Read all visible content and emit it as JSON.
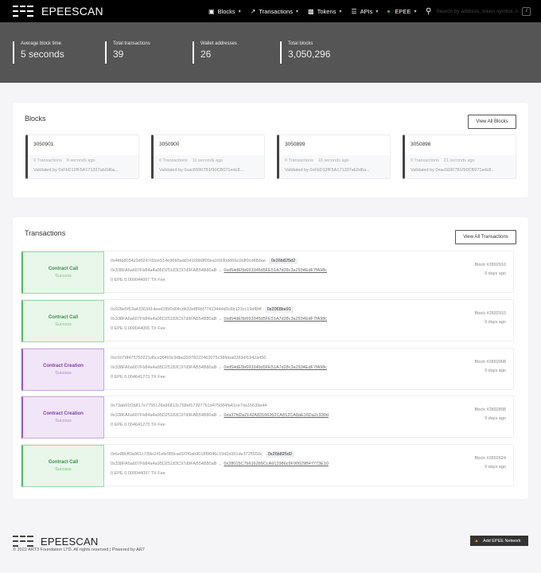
{
  "brand": {
    "name": "EPEESCAN"
  },
  "nav": {
    "items": [
      {
        "label": "Blocks",
        "icon": "cube-icon"
      },
      {
        "label": "Transactions",
        "icon": "transfer-icon"
      },
      {
        "label": "Tokens",
        "icon": "tokens-icon"
      },
      {
        "label": "APIs",
        "icon": "sliders-icon"
      },
      {
        "label": "EPEE",
        "icon": "network-dot-icon"
      }
    ],
    "search_placeholder": "Search by address, token symbol, n",
    "search_shortcut": "/"
  },
  "stats": [
    {
      "label": "Average block time",
      "value": "5 seconds"
    },
    {
      "label": "Total transactions",
      "value": "39"
    },
    {
      "label": "Wallet addresses",
      "value": "26"
    },
    {
      "label": "Total blocks",
      "value": "3,050,296"
    }
  ],
  "blocks": {
    "title": "Blocks",
    "view_all": "View All Blocks",
    "items": [
      {
        "number": "3050901",
        "tx_count": "0 Transactions",
        "age": "6 seconds ago",
        "validator": "Validated by 0xFbD12fF5A171337ab2d6a..."
      },
      {
        "number": "3050900",
        "tx_count": "0 Transactions",
        "age": "11 seconds ago",
        "validator": "Validated by 0xac66907B1f90CB071edc8..."
      },
      {
        "number": "3050899",
        "tx_count": "0 Transactions",
        "age": "16 seconds ago",
        "validator": "Validated by 0xFbD12fF5A171337ab2d6a..."
      },
      {
        "number": "3050898",
        "tx_count": "0 Transactions",
        "age": "21 seconds ago",
        "validator": "Validated by 0xac66907B1f90CB071edc8..."
      }
    ]
  },
  "transactions": {
    "title": "Transactions",
    "view_all": "View All Transactions",
    "items": [
      {
        "type": "Contract Call",
        "kind": "call",
        "status": "Success",
        "hash": "0x4fdb8034c0d9247d2ee514e96b5add14106b8f00ea16930dd6fa1bdf0cd88dae",
        "method": "0x26b825d2",
        "from": "0x338FA6a607Fb84a4a95D25183C97d9FAB54B80aB",
        "arrow": "→",
        "to": "0xd54dE5b693345d5FE51A7d28c3a2934EdF7fA98c",
        "value": "0 EPE",
        "fee": "0.000044097 TX Fee",
        "block": "Block #2892910",
        "age": "9 days ago"
      },
      {
        "type": "Contract Call",
        "kind": "call",
        "status": "Success",
        "hash": "0x928e5f53a43363414eed1f5f0d04cdb33ef85bf77413444d3c6b123cc19df84f",
        "method": "0x2068be91",
        "from": "0x338FA6a607Fb84a4a95D25183C97d9FAB54B80aB",
        "arrow": "→",
        "to": "0xd54dE5b693345d5FE51A7d28c3a2934EdF7fA98c",
        "value": "0 EPE",
        "fee": "0.000044056 TX Fee",
        "block": "Block #2892910",
        "age": "9 days ago"
      },
      {
        "type": "Contract Creation",
        "kind": "creation",
        "status": "Success",
        "hash": "0xc007df475750221d5cc06469c9dba29378222462075c38feba0283df1942a450",
        "method": "",
        "from": "0x338FA6a607Fb84a4a95D25183C97d9FAB54B80aB",
        "arrow": "→",
        "to": "0xd54dE5b693345d5FE51A7d28c3a2934EdF7fA98c",
        "value": "0 EPE",
        "fee": "0.004641273 TX Fee",
        "block": "Block #2892908",
        "age": "9 days ago"
      },
      {
        "type": "Contract Creation",
        "kind": "creation",
        "status": "Success",
        "hash": "0x73ab91f2b817e7755128a96813c768ef173977b1d475084fa41ce7da15639e44",
        "method": "",
        "from": "0x338FA6a607Fb84a4a95D25183C97d9FAB54B80aB",
        "arrow": "→",
        "to": "0xa37fd2a2142A83166362CA812CA8aE16Da2c930d",
        "value": "0 EPE",
        "fee": "0.004641273 TX Fee",
        "block": "Block #2892898",
        "age": "9 days ago"
      },
      {
        "type": "Contract Call",
        "kind": "call",
        "status": "Success",
        "hash": "0x6e88cff3a961c739e241efe989cad1f2f6ab9018f9046c1941b951de3725550c",
        "method": "0x26b825d2",
        "from": "0x338FA6a607Fb84a4a95D25183C97d9FAB54B80aB",
        "arrow": "→",
        "to": "0x28015C7b6162b5CcA912986c9F90029B47773E10",
        "value": "0 EPE",
        "fee": "0.000044097 TX Fee",
        "block": "Block #2892624",
        "age": "9 days ago"
      }
    ]
  },
  "footer": {
    "brand": "EPEESCAN",
    "copyright": "© 2022 ART3 Foundation LTD. All rights reserved | Powered by AR7",
    "add_network": "Add EPEE Network"
  },
  "colors": {
    "navbar_bg": "#000000",
    "stats_bg": "#555555",
    "call_accent": "#5bb56a",
    "creation_accent": "#9b59c6"
  }
}
